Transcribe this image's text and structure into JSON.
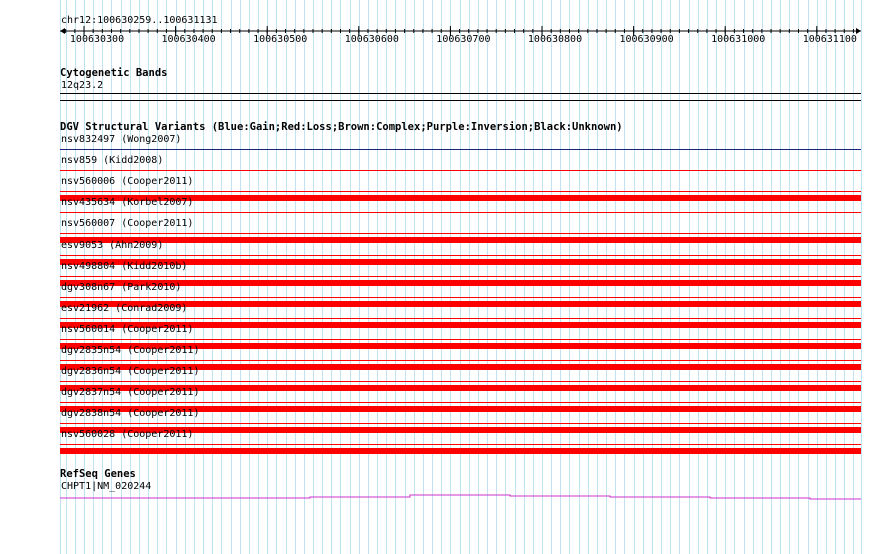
{
  "location": "chr12:100630259..100631131",
  "ruler_ticks": [
    "100630300",
    "100630400",
    "100630500",
    "100630600",
    "100630700",
    "100630800",
    "100630900",
    "100631000",
    "100631100"
  ],
  "cytobands": {
    "title": "Cytogenetic Bands",
    "band": "12q23.2"
  },
  "dgv": {
    "title": "DGV Structural Variants (Blue:Gain;Red:Loss;Brown:Complex;Purple:Inversion;Black:Unknown)",
    "colors": {
      "gain": "#1a237e",
      "loss": "#ff0000"
    },
    "variants": [
      {
        "label": "nsv832497 (Wong2007)",
        "type": "gain",
        "thick": false
      },
      {
        "label": "nsv859 (Kidd2008)",
        "type": "loss",
        "thick": false
      },
      {
        "label": "nsv560006 (Cooper2011)",
        "type": "loss",
        "thick": true
      },
      {
        "label": "nsv435634 (Korbel2007)",
        "type": "loss",
        "thick": false
      },
      {
        "label": "nsv560007 (Cooper2011)",
        "type": "loss",
        "thick": true
      },
      {
        "label": "esv9053 (Ahn2009)",
        "type": "loss",
        "thick": true
      },
      {
        "label": "nsv498804 (Kidd2010b)",
        "type": "loss",
        "thick": true
      },
      {
        "label": "dgv308n67 (Park2010)",
        "type": "loss",
        "thick": true
      },
      {
        "label": "esv21962 (Conrad2009)",
        "type": "loss",
        "thick": true
      },
      {
        "label": "nsv560014 (Cooper2011)",
        "type": "loss",
        "thick": true
      },
      {
        "label": "dgv2835n54 (Cooper2011)",
        "type": "loss",
        "thick": true
      },
      {
        "label": "dgv2836n54 (Cooper2011)",
        "type": "loss",
        "thick": true
      },
      {
        "label": "dgv2837n54 (Cooper2011)",
        "type": "loss",
        "thick": true
      },
      {
        "label": "dgv2838n54 (Cooper2011)",
        "type": "loss",
        "thick": true
      },
      {
        "label": "nsv560028 (Cooper2011)",
        "type": "loss",
        "thick": true
      }
    ]
  },
  "refseq": {
    "title": "RefSeq Genes",
    "gene": "CHPT1|NM_020244",
    "color": "#cc33cc"
  }
}
